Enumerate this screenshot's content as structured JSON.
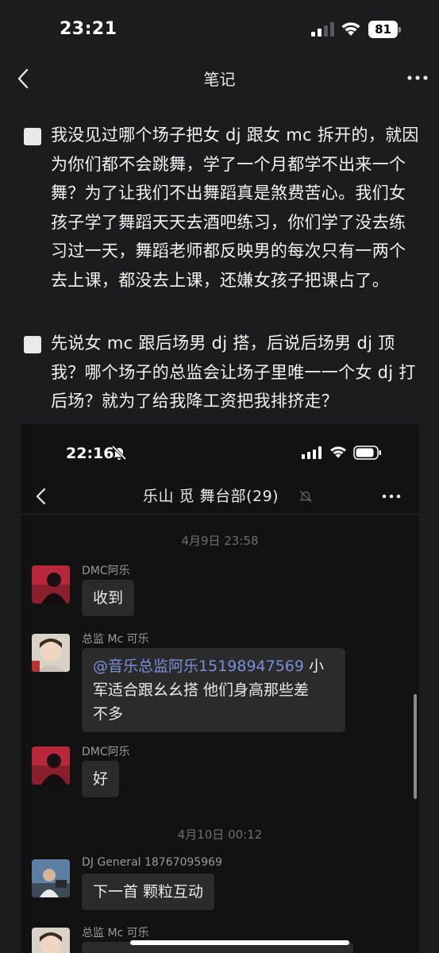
{
  "status_bar": {
    "time": "23:21",
    "battery": "81"
  },
  "nav": {
    "title": "笔记"
  },
  "checklist": [
    {
      "text": "我没见过哪个场子把女 dj 跟女 mc 拆开的，就因为你们都不会跳舞，学了一个月都学不出来一个舞？为了让我们不出舞蹈真是煞费苦心。我们女孩子学了舞蹈天天去酒吧练习，你们学了没去练习过一天，舞蹈老师都反映男的每次只有一两个去上课，都没去上课，还嫌女孩子把课占了。"
    },
    {
      "text": "先说女 mc 跟后场男 dj 搭，后说后场男 dj 顶我？哪个场子的总监会让场子里唯一一个女 dj 打后场？就为了给我降工资把我排挤走？"
    }
  ],
  "embedded": {
    "status_time": "22:16",
    "chat_title": "乐山  觅   舞台部(29)",
    "timestamps": [
      "4月9日 23:58",
      "4月10日 00:12"
    ],
    "messages": [
      {
        "sender": "DMC阿乐",
        "text": "收到"
      },
      {
        "sender": "总监 Mc 可乐",
        "mention": "@音乐总监阿乐",
        "phone": "15198947569",
        "text_line1_tail": " 小",
        "text_line2": "军适合跟幺幺搭 他们身高那些差",
        "text_line3": "不多"
      },
      {
        "sender": "DMC阿乐",
        "text": "好"
      },
      {
        "sender": "DJ General 18767095969",
        "text": "下一首 颗粒互动"
      },
      {
        "sender": "总监 Mc 可乐",
        "text": ""
      }
    ]
  },
  "icons": {
    "back": "chevron-left-icon",
    "more": "ellipsis-icon",
    "checkbox": "checkbox-icon",
    "bell_off": "bell-off-icon"
  },
  "colors": {
    "background": "#1c1c1e",
    "bubble": "#2b2b2b",
    "mention": "#7a8fd8"
  }
}
